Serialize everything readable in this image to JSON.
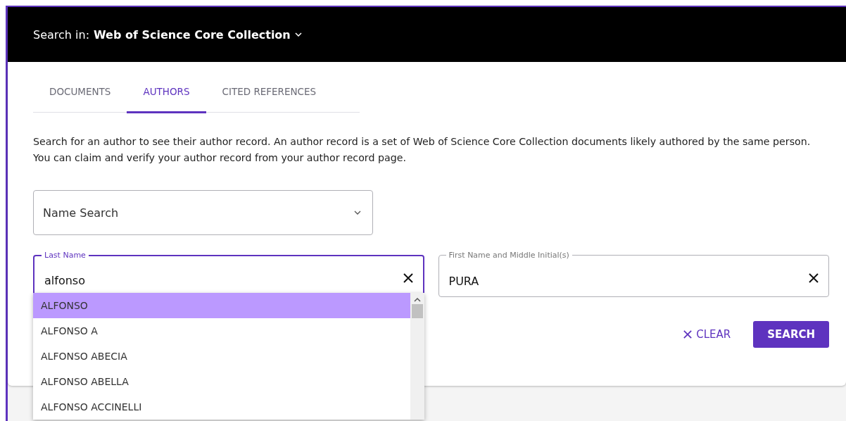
{
  "header": {
    "label": "Search in:",
    "collection": "Web of Science Core Collection"
  },
  "tabs": [
    {
      "label": "DOCUMENTS",
      "selected": false
    },
    {
      "label": "AUTHORS",
      "selected": true
    },
    {
      "label": "CITED REFERENCES",
      "selected": false
    }
  ],
  "description": "Search for an author to see their author record. An author record is a set of Web of Science Core Collection documents likely authored by the same person. You can claim and verify your author record from your author record page.",
  "search_type": {
    "value": "Name Search"
  },
  "last_name": {
    "label": "Last Name",
    "value": "alfonso",
    "focused": true
  },
  "first_name": {
    "label": "First Name and Middle Initial(s)",
    "value": "PURA",
    "focused": false
  },
  "suggestions": [
    {
      "label": "ALFONSO",
      "selected": true
    },
    {
      "label": "ALFONSO A",
      "selected": false
    },
    {
      "label": "ALFONSO ABECIA",
      "selected": false
    },
    {
      "label": "ALFONSO ABELLA",
      "selected": false
    },
    {
      "label": "ALFONSO ACCINELLI",
      "selected": false
    }
  ],
  "buttons": {
    "clear": "CLEAR",
    "search": "SEARCH"
  }
}
